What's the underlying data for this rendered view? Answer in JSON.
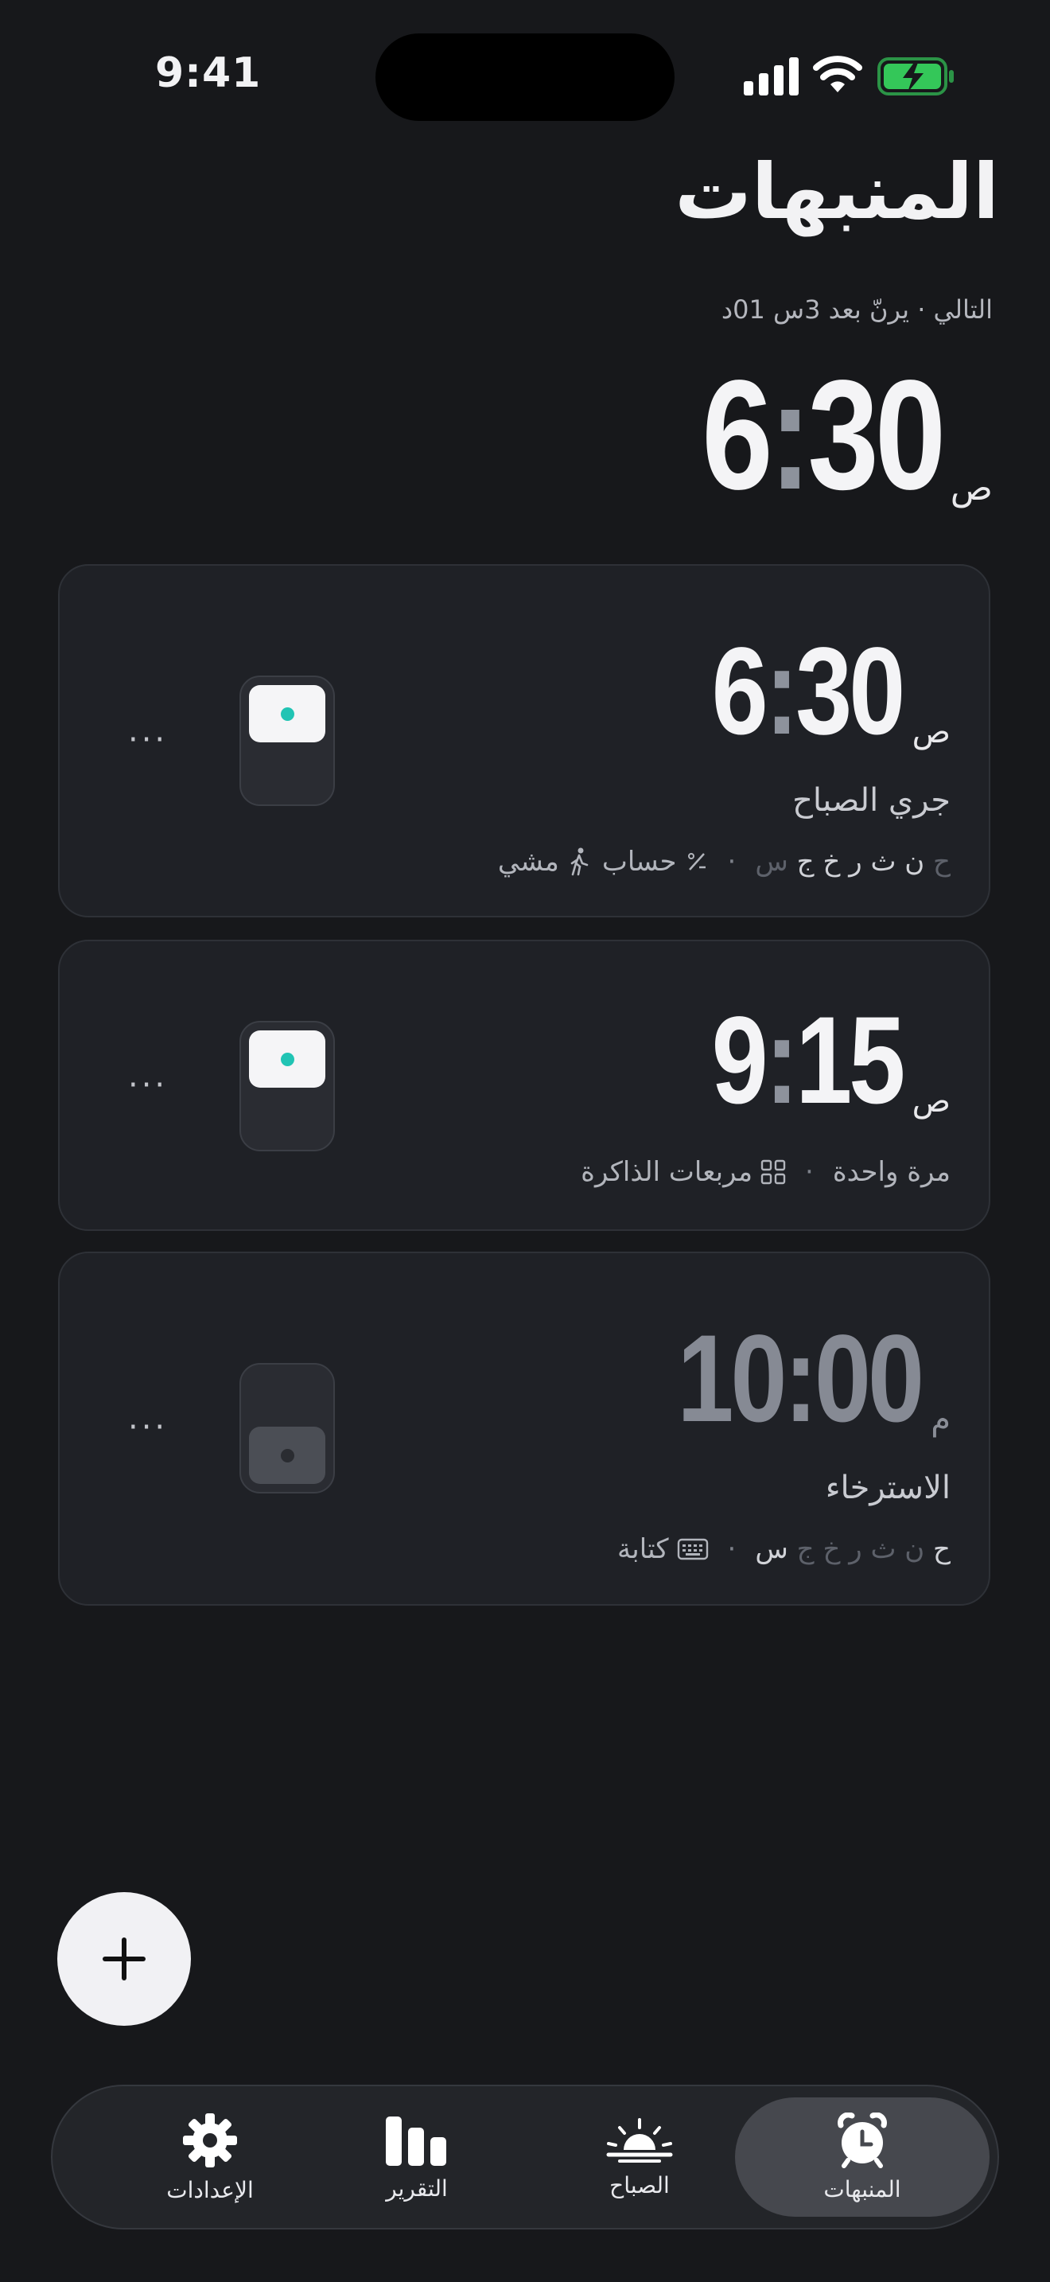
{
  "status_bar": {
    "time": "9:41"
  },
  "header": {
    "title": "المنبهات",
    "next_info": "التالي · يرنّ بعد 3س 01د",
    "next_time": {
      "hour": "6",
      "minutes": "30",
      "ampm": "ص"
    }
  },
  "alarms": [
    {
      "hour": "6",
      "minutes": "30",
      "ampm": "ص",
      "label": "جري الصباح",
      "enabled": true,
      "days": [
        "ح",
        "ن",
        "ث",
        "ر",
        "خ",
        "ج",
        "س"
      ],
      "days_active": [
        false,
        true,
        true,
        true,
        true,
        true,
        false
      ],
      "missions": [
        {
          "name": "حساب",
          "icon": "percent-icon"
        },
        {
          "name": "مشي",
          "icon": "walk-icon"
        }
      ]
    },
    {
      "hour": "9",
      "minutes": "15",
      "ampm": "ص",
      "enabled": true,
      "repeat": "مرة واحدة",
      "missions": [
        {
          "name": "مربعات الذاكرة",
          "icon": "grid-icon"
        }
      ]
    },
    {
      "hour": "10",
      "minutes": "00",
      "ampm": "م",
      "label": "الاسترخاء",
      "enabled": false,
      "days": [
        "ح",
        "ن",
        "ث",
        "ر",
        "خ",
        "ج",
        "س"
      ],
      "days_active": [
        true,
        false,
        false,
        false,
        false,
        false,
        true
      ],
      "missions": [
        {
          "name": "كتابة",
          "icon": "keyboard-icon"
        }
      ]
    }
  ],
  "more_label": "···",
  "tabs": [
    {
      "label": "المنبهات",
      "icon": "alarm-clock-icon",
      "active": true
    },
    {
      "label": "الصباح",
      "icon": "sunrise-icon",
      "active": false
    },
    {
      "label": "التقرير",
      "icon": "bar-chart-icon",
      "active": false
    },
    {
      "label": "الإعدادات",
      "icon": "gear-icon",
      "active": false
    }
  ],
  "colors": {
    "background": "#17181b",
    "card": "#1f2126",
    "accent": "#21c4b4",
    "battery": "#34c759"
  }
}
